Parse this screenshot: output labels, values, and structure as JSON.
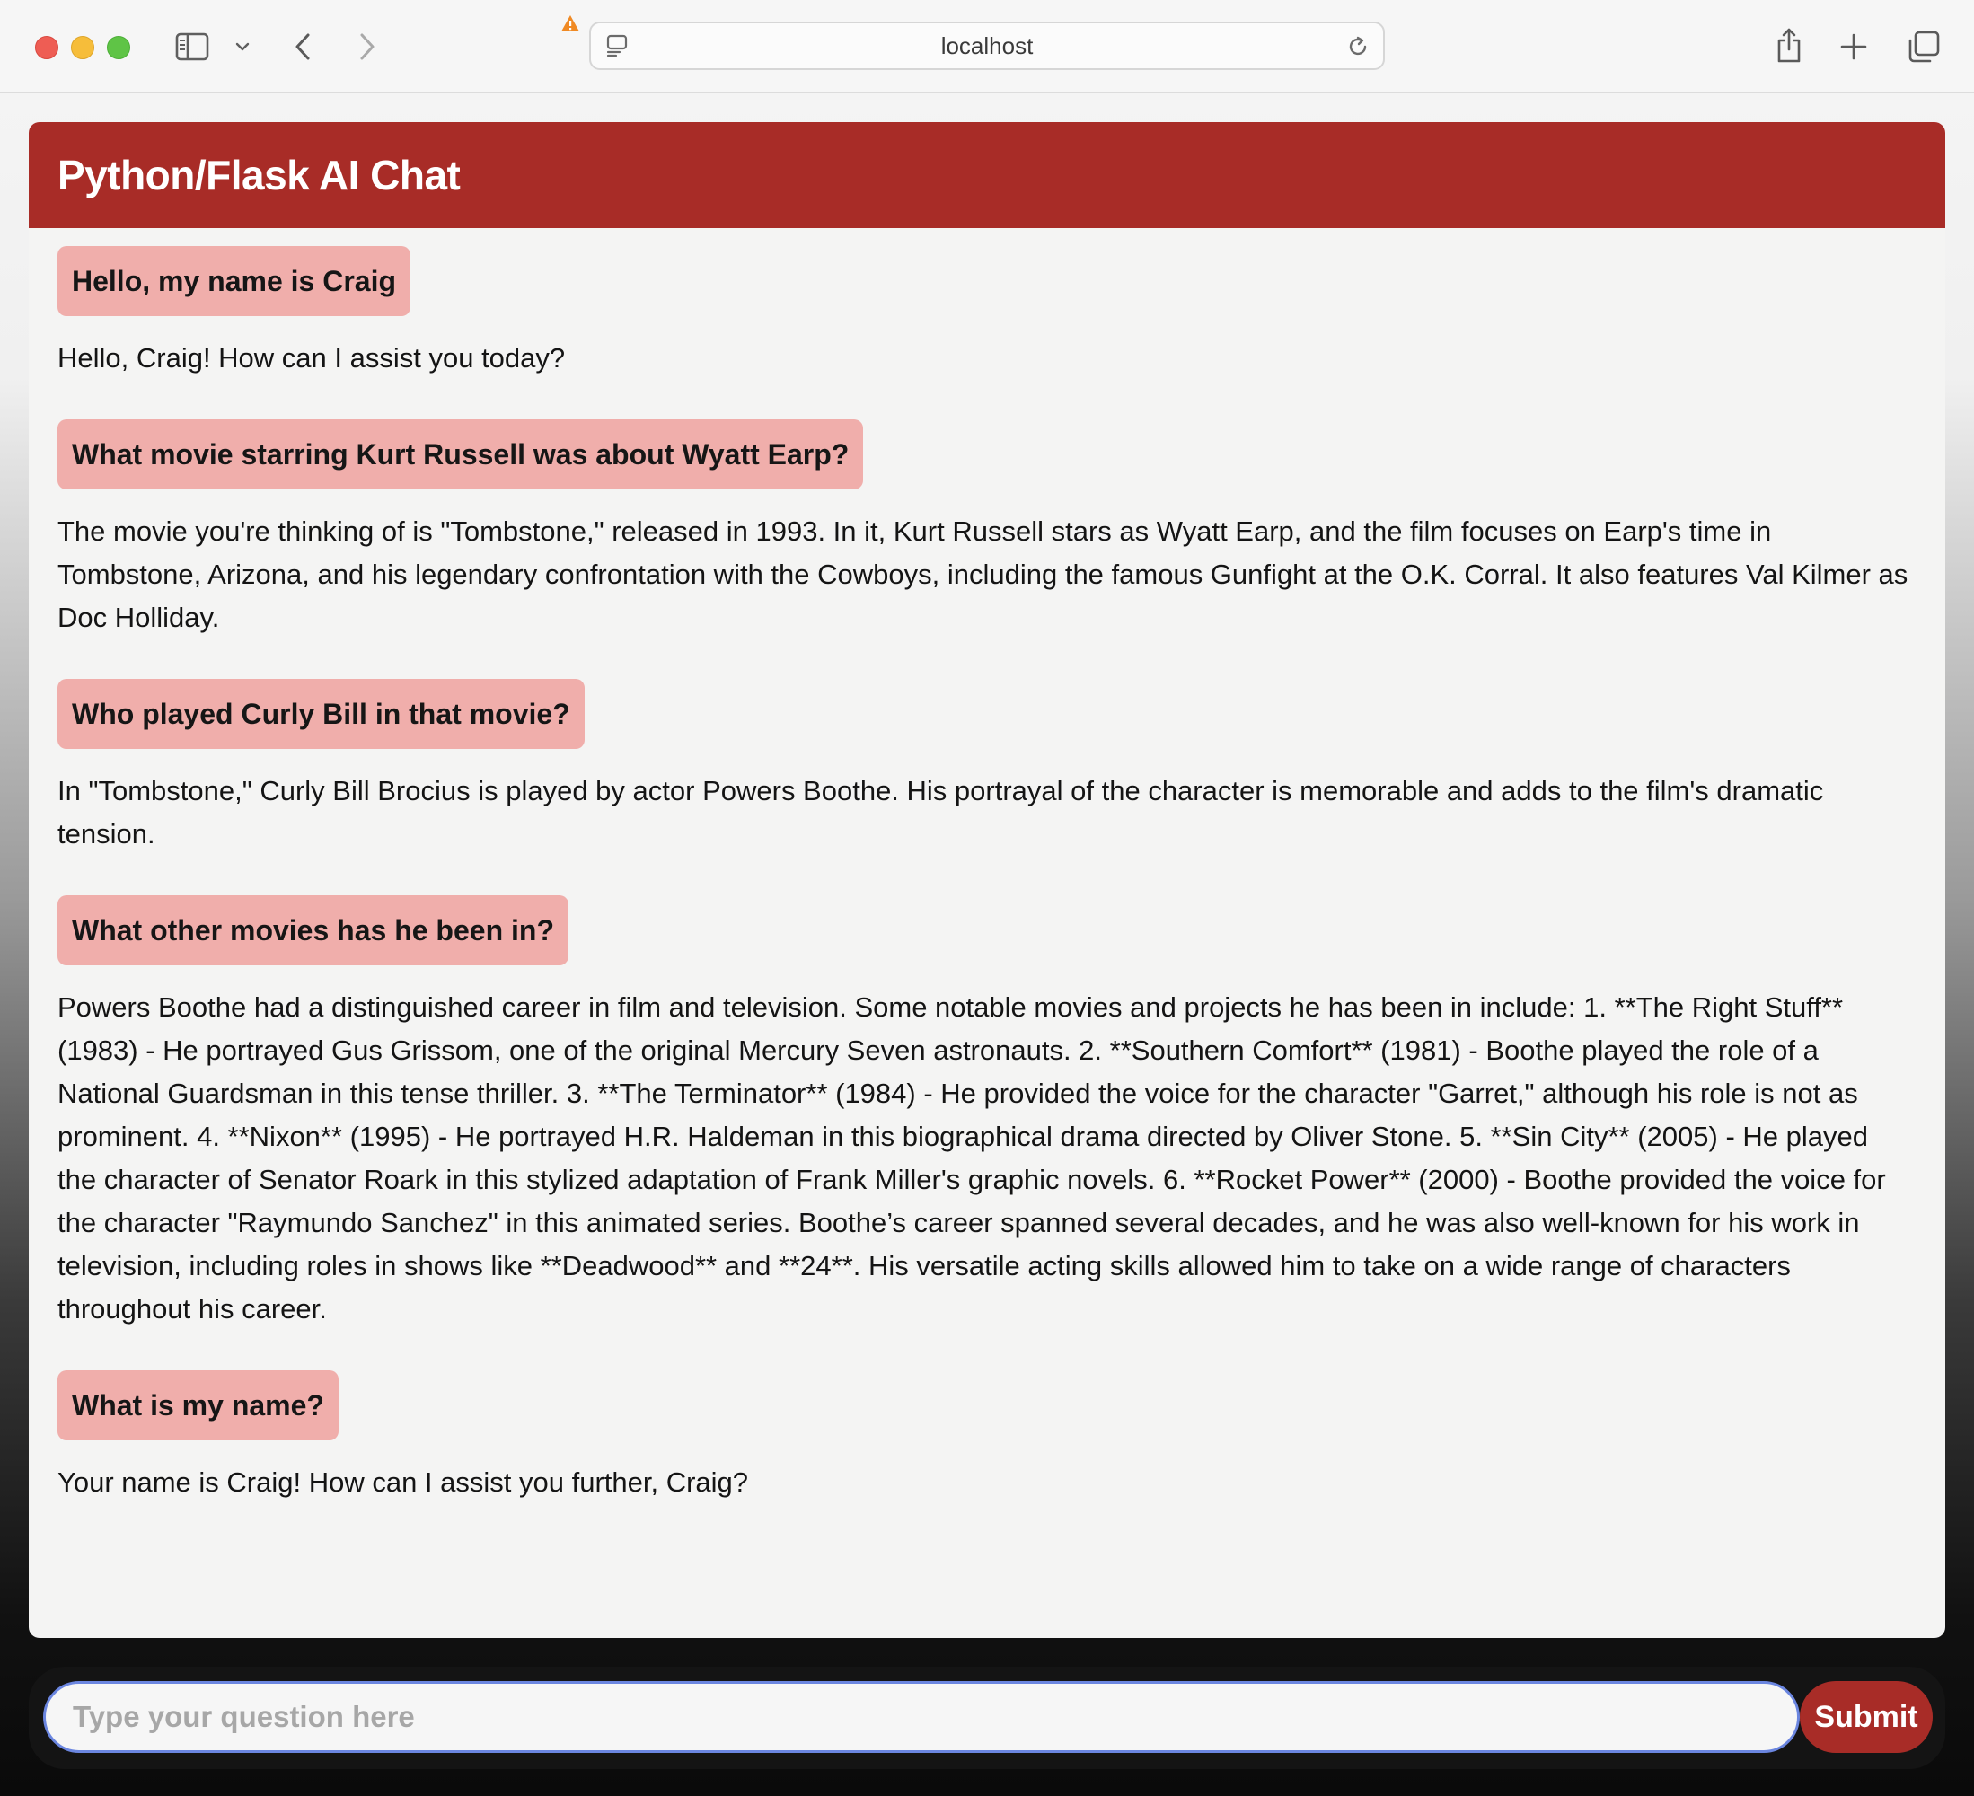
{
  "browser": {
    "url": "localhost",
    "icons": {
      "close": "close-window",
      "minimize": "minimize-window",
      "maximize": "maximize-window",
      "sidebar": "sidebar-icon",
      "sidebar_menu": "chevron-down-icon",
      "back": "chevron-left-icon",
      "forward": "chevron-right-icon",
      "warning": "warning-triangle-icon",
      "page": "page-icon",
      "reload": "reload-icon",
      "share": "share-icon",
      "new_tab": "plus-icon",
      "tabs": "tabs-overview-icon"
    },
    "colors": {
      "close": "#ee5d54",
      "minimize": "#f6bd3a",
      "maximize": "#5fc446",
      "warning": "#f08a24"
    }
  },
  "app": {
    "title": "Python/Flask AI Chat",
    "colors": {
      "header": "#a82c27",
      "user_bubble": "#f0aeab",
      "panel": "#f4f4f3",
      "input_border": "#6b86e0"
    }
  },
  "messages": [
    {
      "question": "Hello, my name is Craig",
      "answer": "Hello, Craig! How can I assist you today?"
    },
    {
      "question": "What movie starring Kurt Russell was about Wyatt Earp?",
      "answer": "The movie you're thinking of is \"Tombstone,\" released in 1993. In it, Kurt Russell stars as Wyatt Earp, and the film focuses on Earp's time in Tombstone, Arizona, and his legendary confrontation with the Cowboys, including the famous Gunfight at the O.K. Corral. It also features Val Kilmer as Doc Holliday."
    },
    {
      "question": "Who played Curly Bill in that movie?",
      "answer": "In \"Tombstone,\" Curly Bill Brocius is played by actor Powers Boothe. His portrayal of the character is memorable and adds to the film's dramatic tension."
    },
    {
      "question": "What other movies has he been in?",
      "answer": "Powers Boothe had a distinguished career in film and television. Some notable movies and projects he has been in include: 1. **The Right Stuff** (1983) - He portrayed Gus Grissom, one of the original Mercury Seven astronauts. 2. **Southern Comfort** (1981) - Boothe played the role of a National Guardsman in this tense thriller. 3. **The Terminator** (1984) - He provided the voice for the character \"Garret,\" although his role is not as prominent. 4. **Nixon** (1995) - He portrayed H.R. Haldeman in this biographical drama directed by Oliver Stone. 5. **Sin City** (2005) - He played the character of Senator Roark in this stylized adaptation of Frank Miller's graphic novels. 6. **Rocket Power** (2000) - Boothe provided the voice for the character \"Raymundo Sanchez\" in this animated series. Boothe’s career spanned several decades, and he was also well-known for his work in television, including roles in shows like **Deadwood** and **24**. His versatile acting skills allowed him to take on a wide range of characters throughout his career."
    },
    {
      "question": "What is my name?",
      "answer": "Your name is Craig! How can I assist you further, Craig?"
    }
  ],
  "input": {
    "value": "",
    "placeholder": "Type your question here"
  },
  "submit_label": "Submit"
}
